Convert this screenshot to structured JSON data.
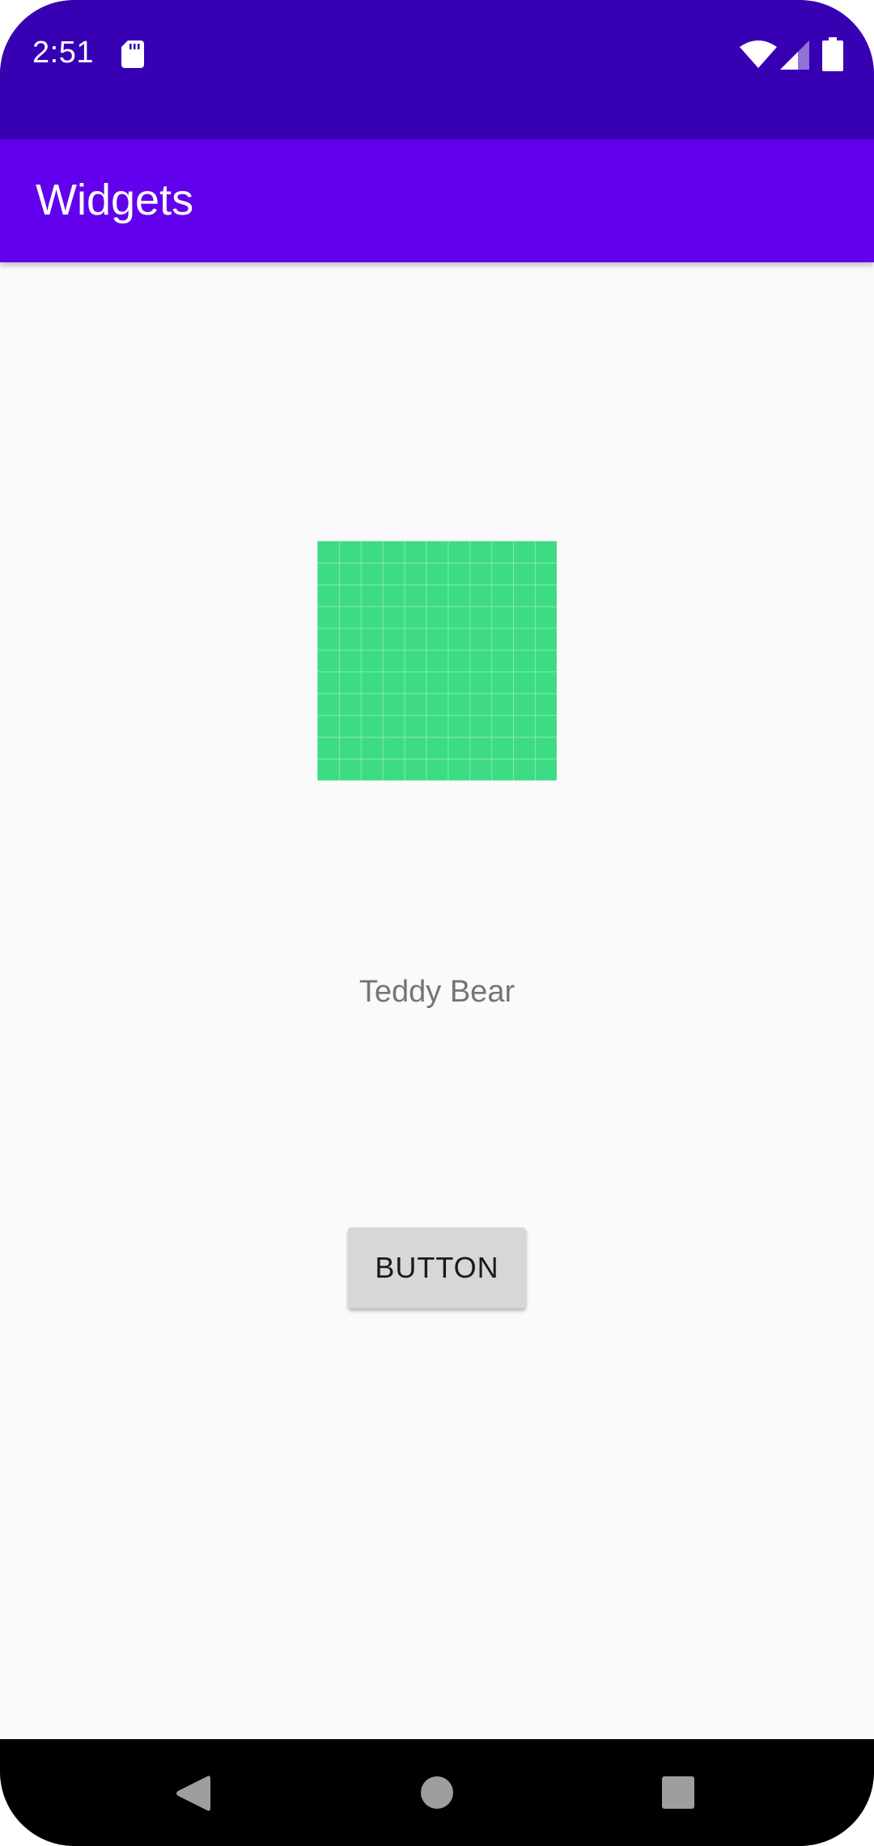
{
  "status_bar": {
    "time": "2:51",
    "icons": [
      "sd-card-icon",
      "wifi-icon",
      "cell-signal-icon",
      "battery-icon"
    ],
    "background": "#3700B3"
  },
  "app_bar": {
    "title": "Widgets",
    "background": "#6200EE"
  },
  "main": {
    "image": {
      "icon": "green-grid-image",
      "color": "#3DDC84"
    },
    "label": "Teddy Bear",
    "button_label": "BUTTON"
  },
  "nav_bar": {
    "icons": [
      "back-icon",
      "home-icon",
      "recents-icon"
    ]
  }
}
